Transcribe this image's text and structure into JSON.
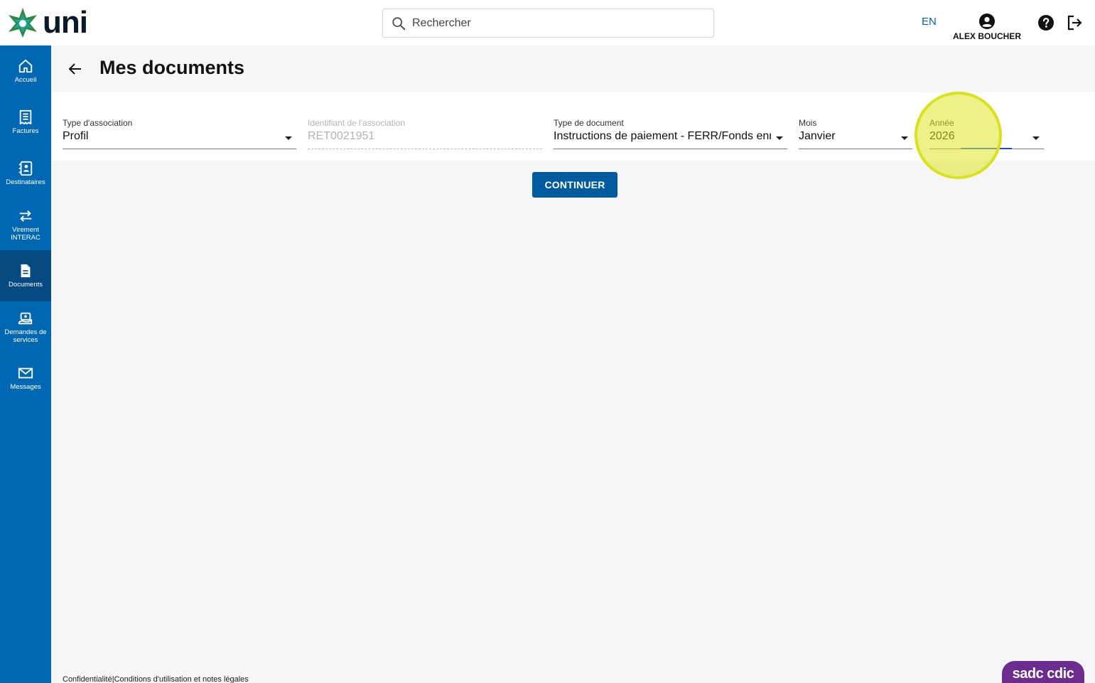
{
  "brand": {
    "name": "uni",
    "logo_icon": "star-logo-icon",
    "colors": {
      "primary": "#0068b3",
      "active_nav": "#044a80",
      "green": "#2e8b3d",
      "teal": "#1aa39a"
    }
  },
  "search": {
    "placeholder": "Rechercher"
  },
  "header": {
    "lang": "EN",
    "user_name": "ALEX BOUCHER"
  },
  "sidebar": {
    "items": [
      {
        "label": "Accueil",
        "icon": "home-icon"
      },
      {
        "label": "Factures",
        "icon": "receipt-icon"
      },
      {
        "label": "Destinataires",
        "icon": "contacts-icon"
      },
      {
        "label": "Virement INTERAC",
        "icon": "transfer-icon"
      },
      {
        "label": "Documents",
        "icon": "document-icon",
        "active": true
      },
      {
        "label": "Demandes de services",
        "icon": "service-request-icon"
      },
      {
        "label": "Messages",
        "icon": "envelope-icon"
      }
    ]
  },
  "page": {
    "title": "Mes documents"
  },
  "form": {
    "association_type": {
      "label": "Type d'association",
      "value": "Profil"
    },
    "association_id": {
      "label": "Identifiant de l'association",
      "value": "RET0021951"
    },
    "document_type": {
      "label": "Type de document",
      "value": "Instructions de paiement - FERR/Fonds enregistré"
    },
    "month": {
      "label": "Mois",
      "value": "Janvier"
    },
    "year": {
      "label": "Année",
      "value": "2026"
    },
    "continue_label": "CONTINUER"
  },
  "footer": {
    "privacy": "Confidentialité",
    "separator": "|",
    "terms": "Conditions d'utilisation et notes légales",
    "badge": "sadc cdic"
  }
}
